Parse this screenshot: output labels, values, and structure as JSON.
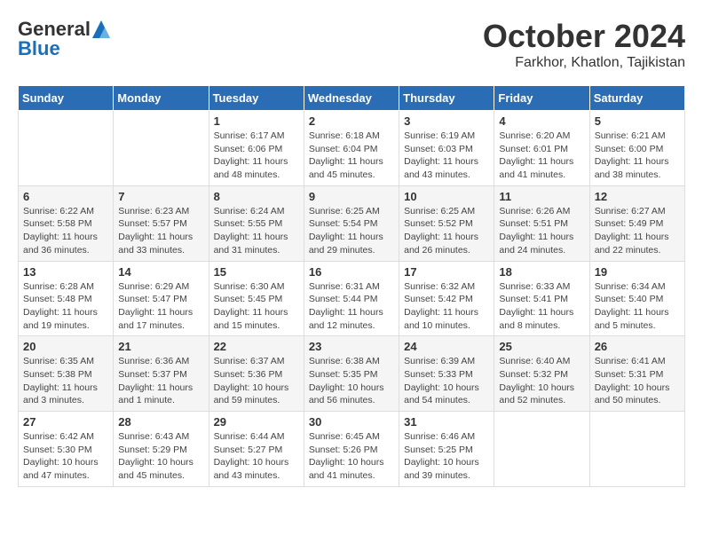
{
  "header": {
    "logo_general": "General",
    "logo_blue": "Blue",
    "month_title": "October 2024",
    "location": "Farkhor, Khatlon, Tajikistan"
  },
  "weekdays": [
    "Sunday",
    "Monday",
    "Tuesday",
    "Wednesday",
    "Thursday",
    "Friday",
    "Saturday"
  ],
  "weeks": [
    [
      {
        "day": "",
        "sunrise": "",
        "sunset": "",
        "daylight": ""
      },
      {
        "day": "",
        "sunrise": "",
        "sunset": "",
        "daylight": ""
      },
      {
        "day": "1",
        "sunrise": "Sunrise: 6:17 AM",
        "sunset": "Sunset: 6:06 PM",
        "daylight": "Daylight: 11 hours and 48 minutes."
      },
      {
        "day": "2",
        "sunrise": "Sunrise: 6:18 AM",
        "sunset": "Sunset: 6:04 PM",
        "daylight": "Daylight: 11 hours and 45 minutes."
      },
      {
        "day": "3",
        "sunrise": "Sunrise: 6:19 AM",
        "sunset": "Sunset: 6:03 PM",
        "daylight": "Daylight: 11 hours and 43 minutes."
      },
      {
        "day": "4",
        "sunrise": "Sunrise: 6:20 AM",
        "sunset": "Sunset: 6:01 PM",
        "daylight": "Daylight: 11 hours and 41 minutes."
      },
      {
        "day": "5",
        "sunrise": "Sunrise: 6:21 AM",
        "sunset": "Sunset: 6:00 PM",
        "daylight": "Daylight: 11 hours and 38 minutes."
      }
    ],
    [
      {
        "day": "6",
        "sunrise": "Sunrise: 6:22 AM",
        "sunset": "Sunset: 5:58 PM",
        "daylight": "Daylight: 11 hours and 36 minutes."
      },
      {
        "day": "7",
        "sunrise": "Sunrise: 6:23 AM",
        "sunset": "Sunset: 5:57 PM",
        "daylight": "Daylight: 11 hours and 33 minutes."
      },
      {
        "day": "8",
        "sunrise": "Sunrise: 6:24 AM",
        "sunset": "Sunset: 5:55 PM",
        "daylight": "Daylight: 11 hours and 31 minutes."
      },
      {
        "day": "9",
        "sunrise": "Sunrise: 6:25 AM",
        "sunset": "Sunset: 5:54 PM",
        "daylight": "Daylight: 11 hours and 29 minutes."
      },
      {
        "day": "10",
        "sunrise": "Sunrise: 6:25 AM",
        "sunset": "Sunset: 5:52 PM",
        "daylight": "Daylight: 11 hours and 26 minutes."
      },
      {
        "day": "11",
        "sunrise": "Sunrise: 6:26 AM",
        "sunset": "Sunset: 5:51 PM",
        "daylight": "Daylight: 11 hours and 24 minutes."
      },
      {
        "day": "12",
        "sunrise": "Sunrise: 6:27 AM",
        "sunset": "Sunset: 5:49 PM",
        "daylight": "Daylight: 11 hours and 22 minutes."
      }
    ],
    [
      {
        "day": "13",
        "sunrise": "Sunrise: 6:28 AM",
        "sunset": "Sunset: 5:48 PM",
        "daylight": "Daylight: 11 hours and 19 minutes."
      },
      {
        "day": "14",
        "sunrise": "Sunrise: 6:29 AM",
        "sunset": "Sunset: 5:47 PM",
        "daylight": "Daylight: 11 hours and 17 minutes."
      },
      {
        "day": "15",
        "sunrise": "Sunrise: 6:30 AM",
        "sunset": "Sunset: 5:45 PM",
        "daylight": "Daylight: 11 hours and 15 minutes."
      },
      {
        "day": "16",
        "sunrise": "Sunrise: 6:31 AM",
        "sunset": "Sunset: 5:44 PM",
        "daylight": "Daylight: 11 hours and 12 minutes."
      },
      {
        "day": "17",
        "sunrise": "Sunrise: 6:32 AM",
        "sunset": "Sunset: 5:42 PM",
        "daylight": "Daylight: 11 hours and 10 minutes."
      },
      {
        "day": "18",
        "sunrise": "Sunrise: 6:33 AM",
        "sunset": "Sunset: 5:41 PM",
        "daylight": "Daylight: 11 hours and 8 minutes."
      },
      {
        "day": "19",
        "sunrise": "Sunrise: 6:34 AM",
        "sunset": "Sunset: 5:40 PM",
        "daylight": "Daylight: 11 hours and 5 minutes."
      }
    ],
    [
      {
        "day": "20",
        "sunrise": "Sunrise: 6:35 AM",
        "sunset": "Sunset: 5:38 PM",
        "daylight": "Daylight: 11 hours and 3 minutes."
      },
      {
        "day": "21",
        "sunrise": "Sunrise: 6:36 AM",
        "sunset": "Sunset: 5:37 PM",
        "daylight": "Daylight: 11 hours and 1 minute."
      },
      {
        "day": "22",
        "sunrise": "Sunrise: 6:37 AM",
        "sunset": "Sunset: 5:36 PM",
        "daylight": "Daylight: 10 hours and 59 minutes."
      },
      {
        "day": "23",
        "sunrise": "Sunrise: 6:38 AM",
        "sunset": "Sunset: 5:35 PM",
        "daylight": "Daylight: 10 hours and 56 minutes."
      },
      {
        "day": "24",
        "sunrise": "Sunrise: 6:39 AM",
        "sunset": "Sunset: 5:33 PM",
        "daylight": "Daylight: 10 hours and 54 minutes."
      },
      {
        "day": "25",
        "sunrise": "Sunrise: 6:40 AM",
        "sunset": "Sunset: 5:32 PM",
        "daylight": "Daylight: 10 hours and 52 minutes."
      },
      {
        "day": "26",
        "sunrise": "Sunrise: 6:41 AM",
        "sunset": "Sunset: 5:31 PM",
        "daylight": "Daylight: 10 hours and 50 minutes."
      }
    ],
    [
      {
        "day": "27",
        "sunrise": "Sunrise: 6:42 AM",
        "sunset": "Sunset: 5:30 PM",
        "daylight": "Daylight: 10 hours and 47 minutes."
      },
      {
        "day": "28",
        "sunrise": "Sunrise: 6:43 AM",
        "sunset": "Sunset: 5:29 PM",
        "daylight": "Daylight: 10 hours and 45 minutes."
      },
      {
        "day": "29",
        "sunrise": "Sunrise: 6:44 AM",
        "sunset": "Sunset: 5:27 PM",
        "daylight": "Daylight: 10 hours and 43 minutes."
      },
      {
        "day": "30",
        "sunrise": "Sunrise: 6:45 AM",
        "sunset": "Sunset: 5:26 PM",
        "daylight": "Daylight: 10 hours and 41 minutes."
      },
      {
        "day": "31",
        "sunrise": "Sunrise: 6:46 AM",
        "sunset": "Sunset: 5:25 PM",
        "daylight": "Daylight: 10 hours and 39 minutes."
      },
      {
        "day": "",
        "sunrise": "",
        "sunset": "",
        "daylight": ""
      },
      {
        "day": "",
        "sunrise": "",
        "sunset": "",
        "daylight": ""
      }
    ]
  ]
}
